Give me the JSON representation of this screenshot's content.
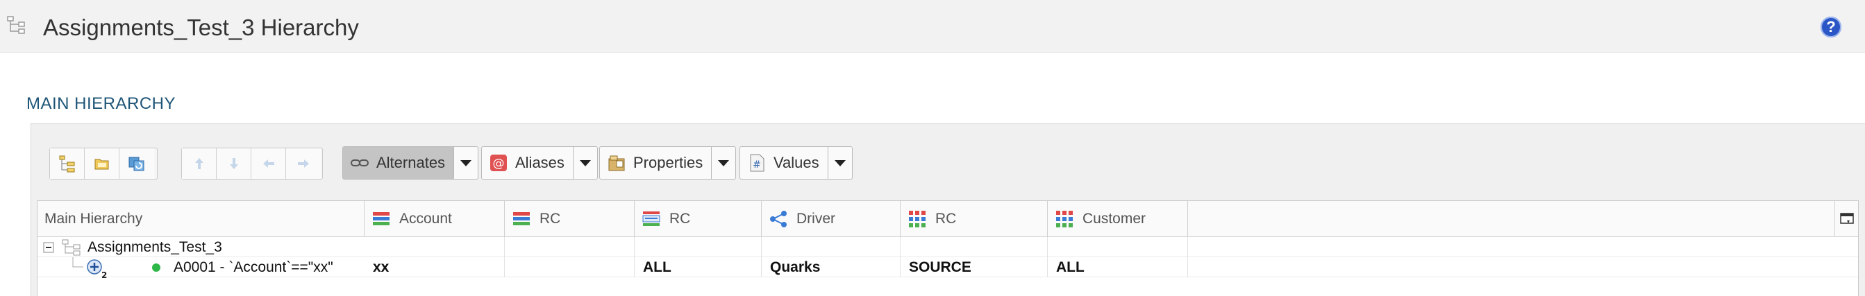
{
  "header": {
    "title": "Assignments_Test_3 Hierarchy",
    "title_icon": "hierarchy-icon",
    "help_icon": "help-icon",
    "help_glyph": "?"
  },
  "section": {
    "title": "MAIN HIERARCHY"
  },
  "toolbar": {
    "group1": [
      "hierarchy-view-icon",
      "folder-icon",
      "refresh-icon"
    ],
    "group2": [
      "arrow-up-icon",
      "arrow-down-icon",
      "arrow-left-icon",
      "arrow-right-icon"
    ],
    "alternates_label": "Alternates",
    "aliases_label": "Aliases",
    "properties_label": "Properties",
    "values_label": "Values"
  },
  "grid": {
    "columns": [
      {
        "label": "Main Hierarchy",
        "icon": ""
      },
      {
        "label": "Account",
        "icon": "dimension-stack-icon"
      },
      {
        "label": "RC",
        "icon": "dimension-stack-icon"
      },
      {
        "label": "RC",
        "icon": "dimension-list-icon"
      },
      {
        "label": "Driver",
        "icon": "share-icon"
      },
      {
        "label": "RC",
        "icon": "grid-dots-icon"
      },
      {
        "label": "Customer",
        "icon": "grid-dots-icon"
      }
    ],
    "rows": [
      {
        "name": "Assignments_Test_3",
        "values": [
          "",
          "",
          "",
          "",
          "",
          ""
        ]
      },
      {
        "name": "A0001 - `Account`==\"xx\"",
        "values": [
          "xx",
          "",
          "ALL",
          "Quarks",
          "SOURCE",
          "ALL"
        ]
      }
    ]
  },
  "colors": {
    "accent": "#1e5577",
    "help": "#2a56c6",
    "status_green": "#2fb84a"
  }
}
